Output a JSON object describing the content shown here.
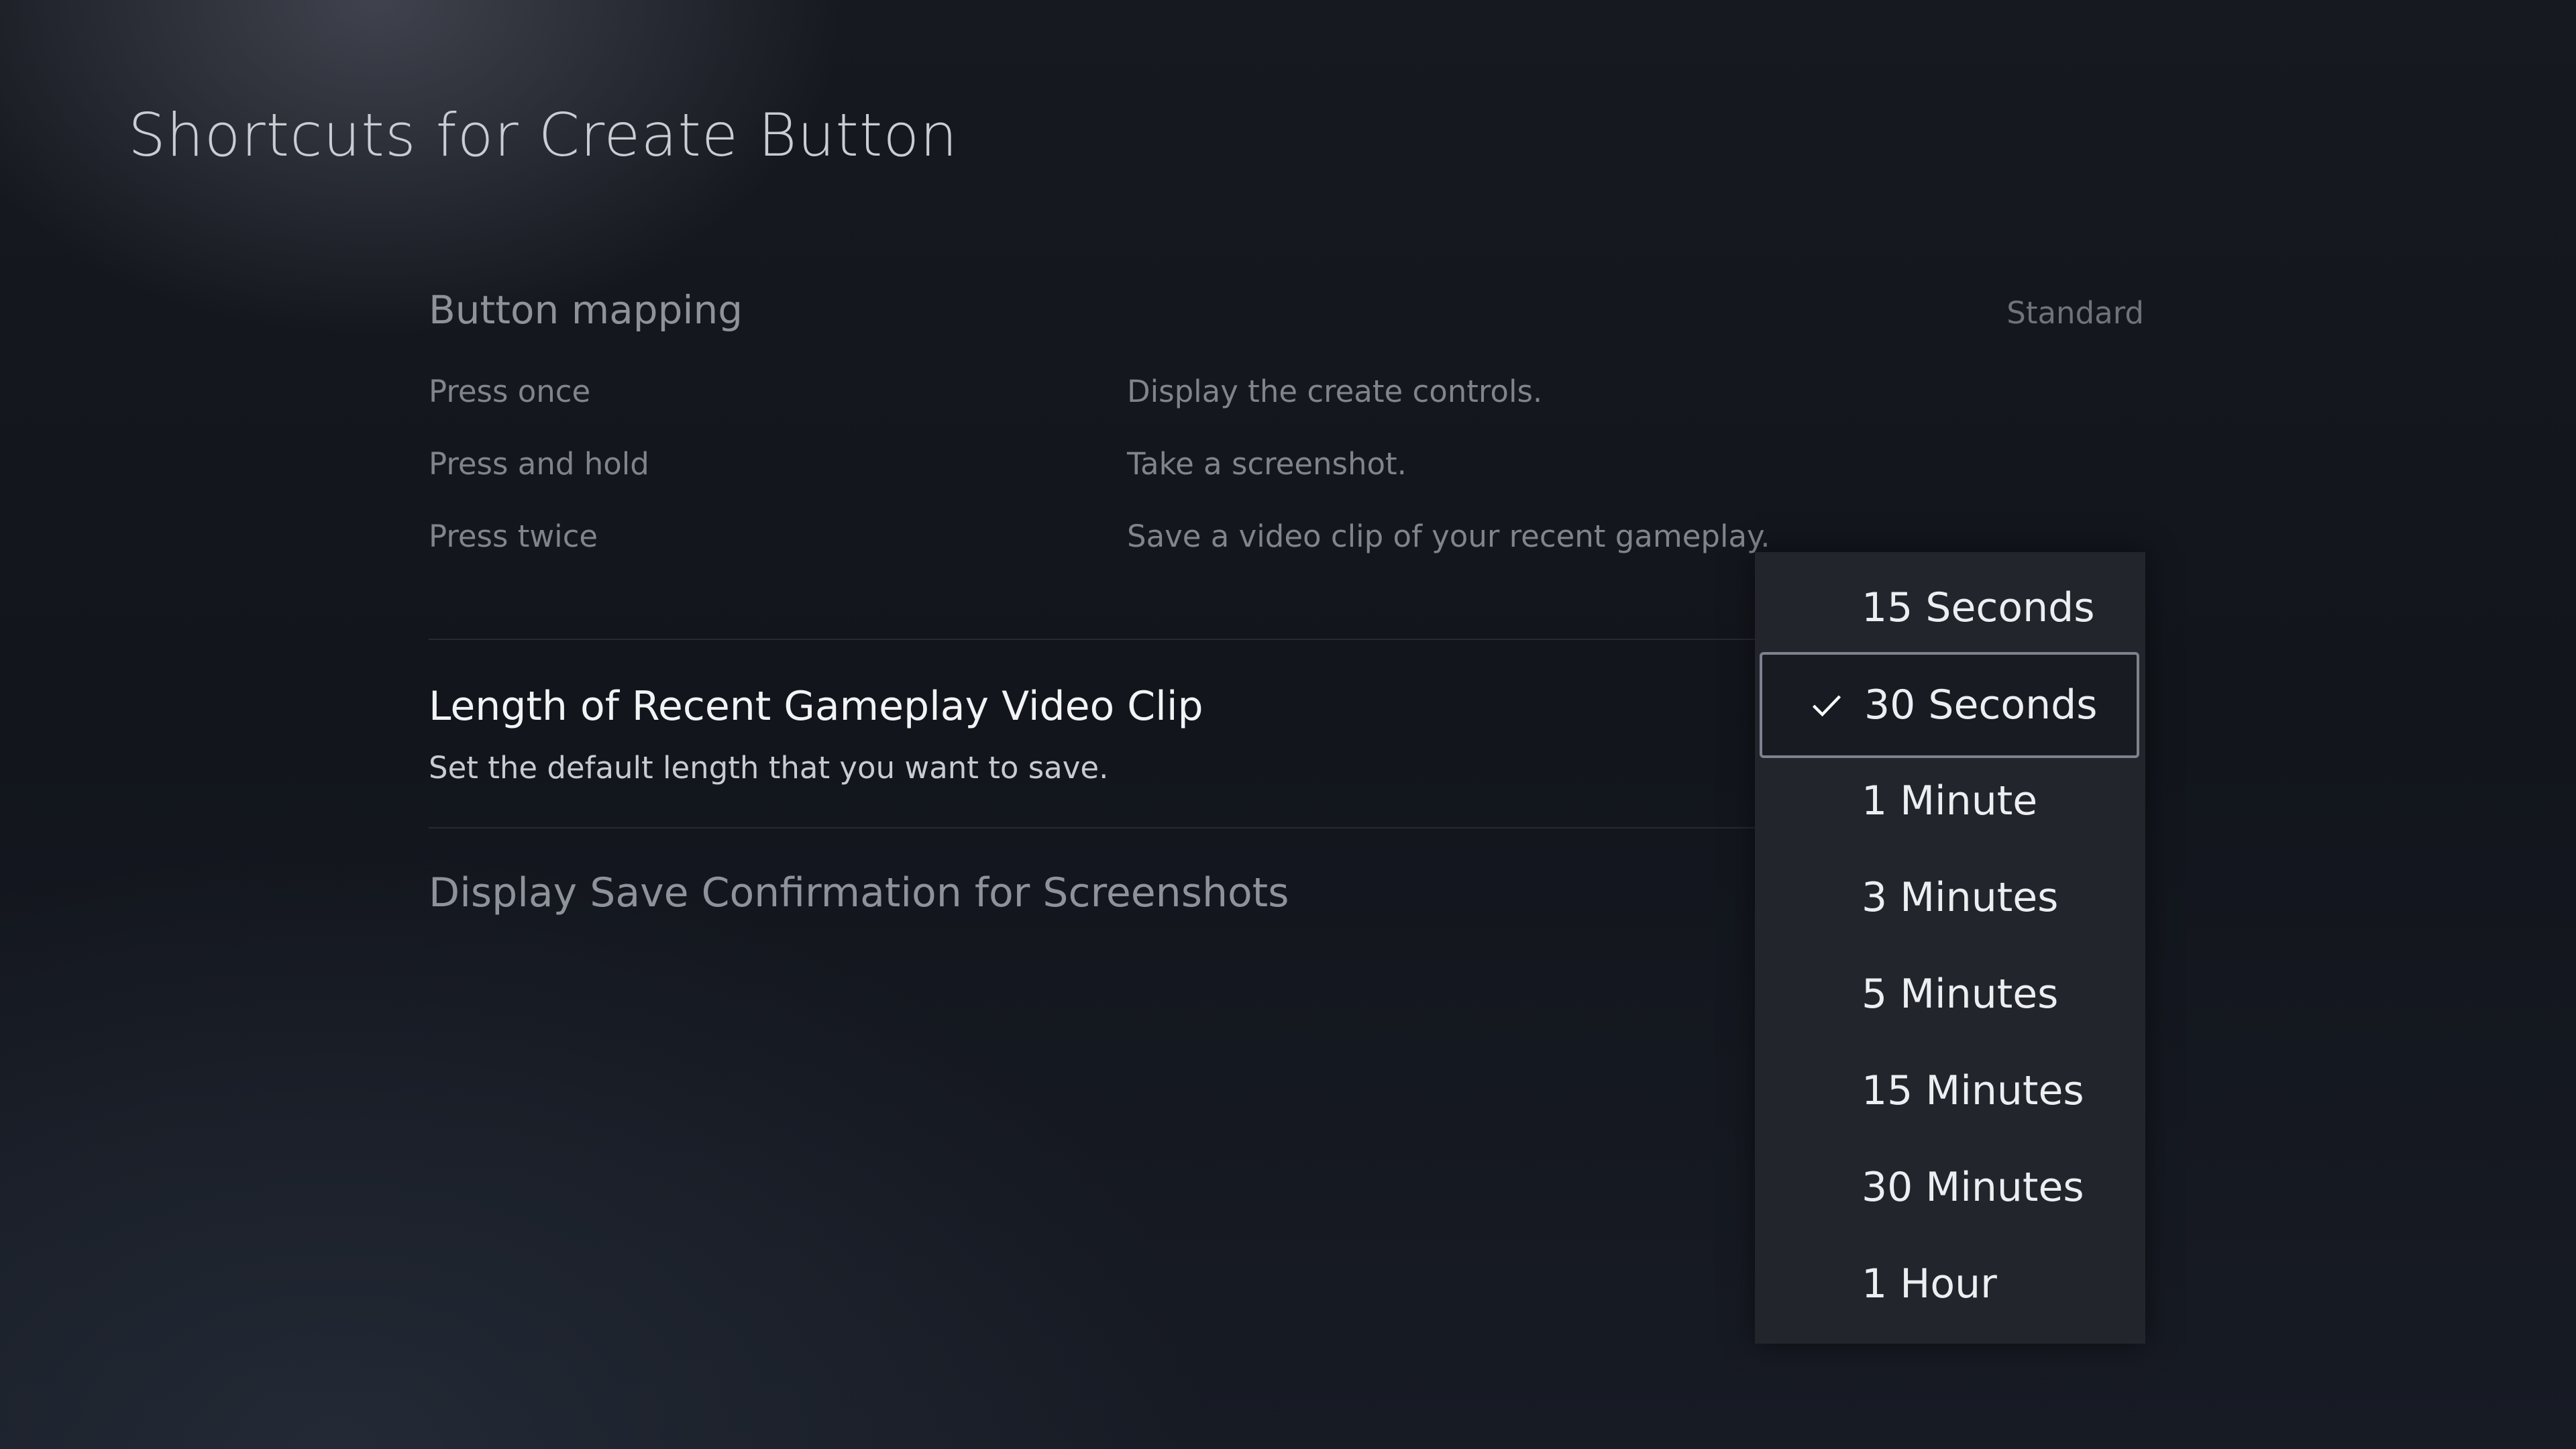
{
  "page": {
    "title": "Shortcuts for Create Button"
  },
  "button_mapping": {
    "label": "Button mapping",
    "value": "Standard",
    "rows": [
      {
        "action": "Press once",
        "result": "Display the create controls."
      },
      {
        "action": "Press and hold",
        "result": "Take a screenshot."
      },
      {
        "action": "Press twice",
        "result": "Save a video clip of your recent gameplay."
      }
    ]
  },
  "clip_length": {
    "title": "Length of Recent Gameplay Video Clip",
    "description": "Set the default length that you want to save."
  },
  "save_confirmation": {
    "title": "Display Save Confirmation for Screenshots"
  },
  "dropdown": {
    "selected_index": 1,
    "options": [
      "15 Seconds",
      "30 Seconds",
      "1 Minute",
      "3 Minutes",
      "5 Minutes",
      "15 Minutes",
      "30 Minutes",
      "1 Hour"
    ]
  }
}
